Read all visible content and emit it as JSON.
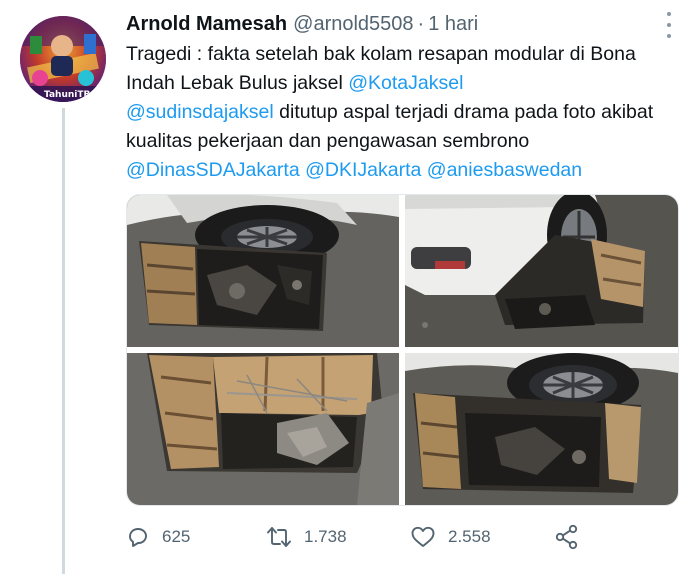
{
  "tweet": {
    "avatar_caption": "TahuniTB",
    "author_name": "Arnold Mamesah",
    "author_handle": "@arnold5508",
    "separator": "·",
    "time": "1 hari",
    "text_part1": "Tragedi : fakta setelah bak kolam resapan modular di Bona Indah Lebak Bulus jaksel ",
    "mention1": "@KotaJaksel",
    "mention2": "@sudinsdajaksel",
    "text_part2": " ditutup aspal terjadi drama pada foto akibat kualitas pekerjaan dan pengawasan sembrono ",
    "mention3": "@DinasSDAJakarta",
    "mention4": "@DKIJakarta",
    "mention5": "@aniesbaswedan",
    "photos": [
      {
        "description": "car tire beside collapsed sinkhole"
      },
      {
        "description": "white car rear beside sinkhole"
      },
      {
        "description": "open pit with broken asphalt"
      },
      {
        "description": "car wheel above collapsed hole"
      }
    ]
  },
  "actions": {
    "reply_count": "625",
    "retweet_count": "1.738",
    "like_count": "2.558"
  },
  "icons": {
    "reply": "reply-icon",
    "retweet": "retweet-icon",
    "like": "heart-icon",
    "share": "share-icon",
    "more": "more-options-icon"
  },
  "colors": {
    "mention": "#1d9bf0",
    "secondary_text": "#536471",
    "primary_text": "#0f1419"
  }
}
